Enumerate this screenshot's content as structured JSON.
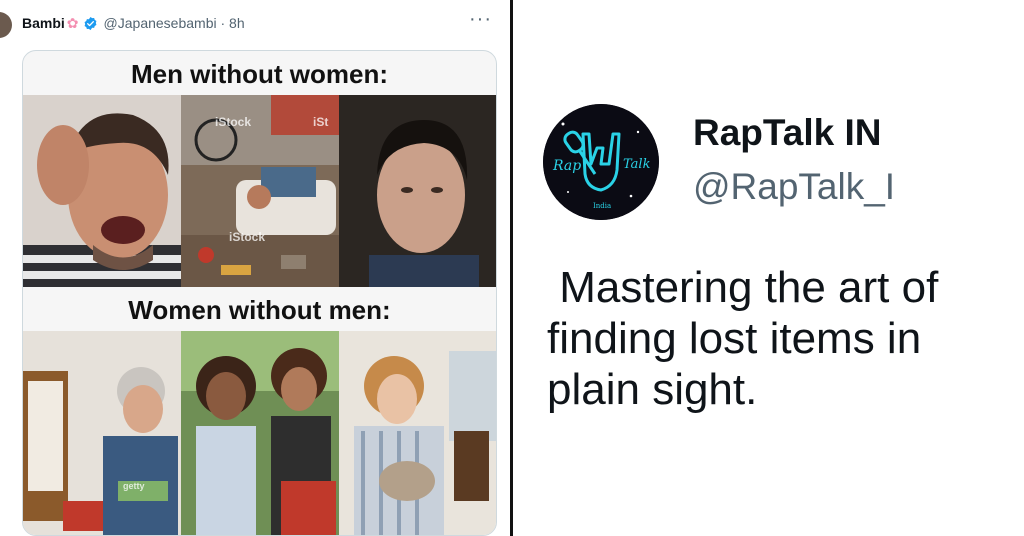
{
  "left_tweet": {
    "name": "Bambi",
    "handle": "@Japanesebambi",
    "separator": "·",
    "time": "8h",
    "more_label": "···",
    "meme": {
      "top_caption": "Men without women:",
      "bottom_caption": "Women without men:",
      "watermarks": [
        "iStock",
        "iSt",
        "iStock",
        "iStock",
        "getty"
      ]
    }
  },
  "right_tweet": {
    "name": "RapTalk IN",
    "handle": "@RapTalk_I",
    "text": " Mastering the art of\nfinding lost items in\nplain sight.",
    "avatar_text": {
      "left": "Rap",
      "right": "Talk",
      "bottom": "India"
    }
  },
  "colors": {
    "verified_blue": "#1d9bf0",
    "avatar_cyan": "#2ad2e6",
    "divider": "#111111"
  }
}
